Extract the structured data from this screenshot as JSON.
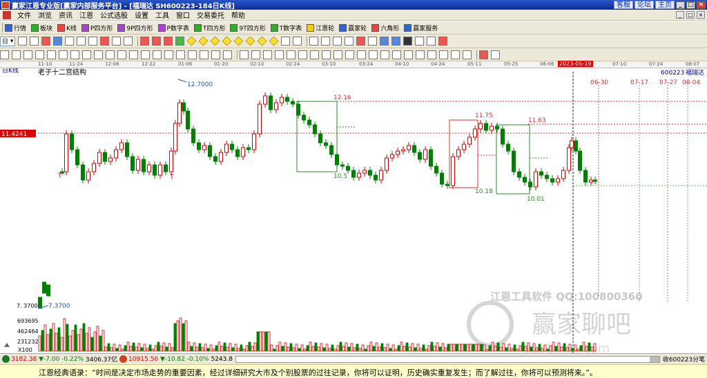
{
  "window": {
    "title": "赢家江恩专业版[赢家内部服务平台] - [福瑞达 SH600223-184日K线]",
    "links": [
      "客服",
      "论坛",
      "主页"
    ],
    "controls": [
      "_",
      "□",
      "×"
    ]
  },
  "menu": [
    "文件",
    "浏览",
    "资讯",
    "江恩",
    "公式选股",
    "设置",
    "工具",
    "窗口",
    "交易委托",
    "帮助"
  ],
  "toolbar1": [
    {
      "label": "行情",
      "icon": "quote-grid-icon"
    },
    {
      "label": "板块",
      "icon": "sector-icon"
    },
    {
      "label": "K线",
      "icon": "kline-icon"
    },
    {
      "label": "P四方形",
      "icon": "p-square-icon"
    },
    {
      "label": "9P四方形",
      "icon": "9p-square-icon"
    },
    {
      "label": "P数字表",
      "icon": "p-number-table-icon"
    },
    {
      "label": "T四方形",
      "icon": "t-square-icon"
    },
    {
      "label": "9T四方形",
      "icon": "9t-square-icon"
    },
    {
      "label": "T数字表",
      "icon": "t-number-table-icon"
    },
    {
      "label": "江恩轮",
      "icon": "gann-wheel-icon"
    },
    {
      "label": "赢家轮",
      "icon": "winner-wheel-icon"
    },
    {
      "label": "六角形",
      "icon": "hexagon-icon"
    },
    {
      "label": "赢家服务",
      "icon": "winner-service-icon"
    }
  ],
  "period_combo": "日",
  "dates": [
    "11-10",
    "11-24",
    "12-08",
    "12-22",
    "01-06",
    "01-20",
    "02-10",
    "02-24",
    "03-10",
    "03-24",
    "04-10",
    "04-24",
    "05-11",
    "05-25",
    "06-06",
    "07-10",
    "07-24",
    "08-07"
  ],
  "highlight_date": "2023-06-19",
  "chart": {
    "mode_label": "日K线",
    "overlay_title": "老子十二宫结构",
    "stock_code": "600223",
    "stock_name": "福瑞达",
    "cursor_price": "11.4241",
    "high_label": "12.7000",
    "low_label": "7.3700",
    "low_label_left": "7. 3700",
    "top_dates": [
      "06-30",
      "07-17",
      "07-27",
      "08-04"
    ],
    "level_labels": {
      "l1216": "12.16",
      "l1175": "11.75",
      "l1163": "11.63",
      "l1050": "10.5",
      "l1018": "10.18",
      "l1001": "10.01"
    },
    "volume_ticks": [
      "693695",
      "462464",
      "231232"
    ],
    "volume_unit": "X100",
    "t_marks": [
      "T",
      "T"
    ],
    "watermark1": "江恩工具软件  QQ:100800360",
    "watermark2": "赢家聊吧",
    "watermark3": "jiaoba.yy.com"
  },
  "status": {
    "sh_index": "3182.38",
    "sh_change": "▼-7.00",
    "sh_pct": "-0.22%",
    "sh_amount": "3406.37亿",
    "sz_index": "10915.50",
    "sz_change": "▼-10.82",
    "sz_pct": "-0.10%",
    "sz_amount": "5243.8",
    "right_text": "收600223分笔"
  },
  "quote": "江恩经典语录：“时间是决定市场走势的重要因素，经过详细研究大市及个别股票的过往记录，你将可以证明，历史确实重复发生；而了解过往，你将可以预测将来。”。",
  "colors": {
    "up": "#d00000",
    "down": "#008000",
    "cursor": "#d00000",
    "box": "#008000"
  }
}
